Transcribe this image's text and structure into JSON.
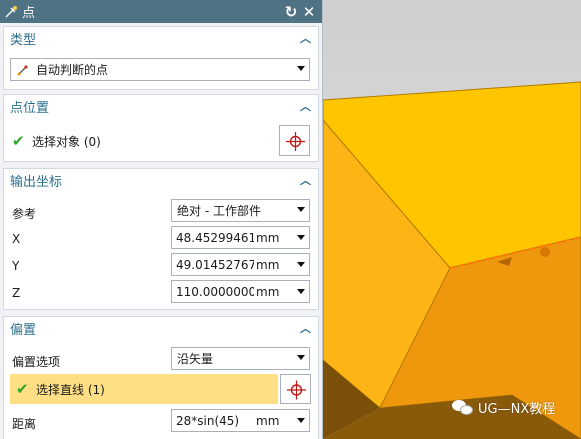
{
  "dialog": {
    "title": "点",
    "reset_icon": "reset-icon",
    "close_icon": "close-icon"
  },
  "type_group": {
    "header": "类型",
    "selected": "自动判断的点"
  },
  "point_location": {
    "header": "点位置",
    "select_label": "选择对象 (0)"
  },
  "output_coords": {
    "header": "输出坐标",
    "reference_label": "参考",
    "reference_value": "绝对 - 工作部件",
    "x_label": "X",
    "x_value": "48.452994616",
    "x_unit": "mm",
    "y_label": "Y",
    "y_value": "49.014527674",
    "y_unit": "mm",
    "z_label": "Z",
    "z_value": "110.00000000",
    "z_unit": "mm"
  },
  "offset": {
    "header": "偏置",
    "option_label": "偏置选项",
    "option_value": "沿矢量",
    "select_line_label": "选择直线 (1)",
    "distance_label": "距离",
    "distance_value": "28*sin(45)",
    "distance_unit": "mm"
  },
  "watermark": {
    "text": "UG—NX教程"
  },
  "colors": {
    "titlebar": "#4f7284",
    "header_text": "#2d6f8c",
    "highlight": "#ffdf84",
    "model_top": "#ffc600",
    "model_side": "#f0980d",
    "model_front": "#fdb515"
  }
}
